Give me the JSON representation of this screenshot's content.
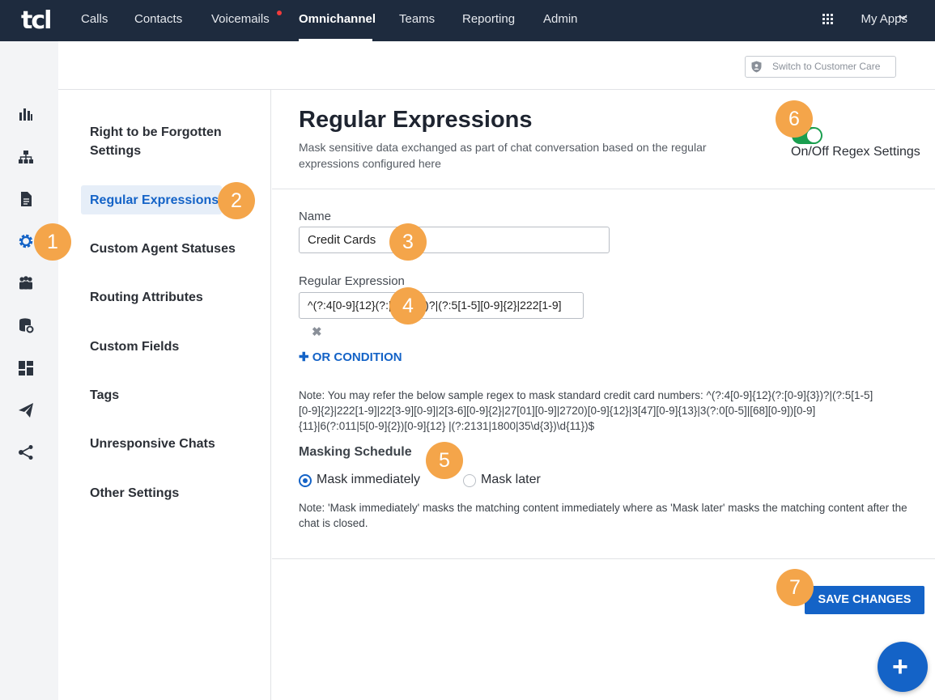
{
  "brand": {
    "logo": "tcl",
    "accent": "#1463c7",
    "nav_bg": "#1e2b3e",
    "badge_color": "#f4a54a"
  },
  "topnav": {
    "items": [
      "Calls",
      "Contacts",
      "Voicemails",
      "Omnichannel",
      "Teams",
      "Reporting",
      "Admin"
    ],
    "active": "Omnichannel",
    "my_apps": "My Apps"
  },
  "rail_icons": [
    "bar-chart-icon",
    "org-chart-icon",
    "document-icon",
    "gear-icon",
    "team-icon",
    "database-settings-icon",
    "dashboard-icon",
    "send-icon",
    "share-icon"
  ],
  "subheader": {
    "switch_label": "Switch to Customer Care"
  },
  "menu": {
    "items": [
      "Right to be Forgotten Settings",
      "Regular Expressions",
      "Custom Agent Statuses",
      "Routing Attributes",
      "Custom Fields",
      "Tags",
      "Unresponsive Chats",
      "Other Settings"
    ],
    "selected": "Regular Expressions"
  },
  "page": {
    "title": "Regular Expressions",
    "description": "Mask sensitive data exchanged as part of chat conversation based on the regular expressions configured here",
    "toggle_label": "On/Off Regex Settings",
    "toggle_on": true
  },
  "form": {
    "name_label": "Name",
    "name_value": "Credit Cards",
    "regex_label": "Regular Expression",
    "regex_value": "^(?:4[0-9]{12}(?:[0-9]{3})?|(?:5[1-5][0-9]{2}|222[1-9]",
    "or_condition": "OR CONDITION",
    "regex_note": "Note: You may refer the below sample regex to mask standard credit card numbers: ^(?:4[0-9]{12}(?:[0-9]{3})?|(?:5[1-5][0-9]{2}|222[1-9]|22[3-9][0-9]|2[3-6][0-9]{2}|27[01][0-9]|2720)[0-9]{12}|3[47][0-9]{13}|3(?:0[0-5]|[68][0-9])[0-9]{11}|6(?:011|5[0-9]{2})[0-9]{12} |(?:2131|1800|35\\d{3})\\d{11})$",
    "masking_title": "Masking Schedule",
    "mask_immediately": "Mask immediately",
    "mask_later": "Mask later",
    "mask_selected": "Mask immediately",
    "mask_note": "Note: 'Mask immediately' masks the matching content immediately where as 'Mask later' masks the matching content after the chat is closed.",
    "save_label": "SAVE CHANGES"
  },
  "fab_label": "+",
  "badges": [
    "1",
    "2",
    "3",
    "4",
    "5",
    "6",
    "7"
  ]
}
